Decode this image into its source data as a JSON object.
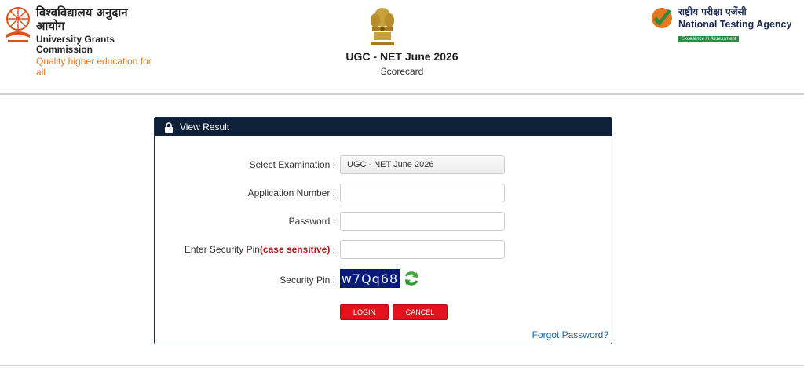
{
  "header": {
    "ugc": {
      "hindi": "विश्वविद्यालय अनुदान आयोग",
      "english": "University Grants Commission",
      "tagline": "Quality higher education for all"
    },
    "nta": {
      "hindi": "राष्ट्रीय परीक्षा एजेंसी",
      "english": "National Testing Agency",
      "tagline": "Excellence in Assessment"
    },
    "title": "UGC - NET June 2026",
    "subtitle": "Scorecard"
  },
  "panel": {
    "heading": "View Result",
    "fields": {
      "exam_label": "Select Examination :",
      "exam_value": "UGC - NET June 2026",
      "app_label": "Application Number :",
      "app_value": "",
      "password_label": "Password :",
      "password_value": "",
      "pin_label": "Enter Security Pin",
      "pin_note": "(case sensitive)",
      "pin_colon": " :",
      "pin_value": "",
      "captcha_label": "Security Pin :",
      "captcha_value": "w7Qq68"
    },
    "buttons": {
      "login": "LOGIN",
      "cancel": "CANCEL"
    },
    "forgot_password": "Forgot Password?"
  },
  "colors": {
    "panel_header": "#0f2139",
    "button": "#e3111b",
    "link": "#1a6aa8",
    "captcha_bg": "#0a1a7a",
    "ugc_tagline": "#e8761d",
    "nta_green": "#2d8a3e"
  },
  "icons": {
    "ugc": "ugc-emblem-icon",
    "national": "state-emblem-icon",
    "nta": "nta-check-icon",
    "lock": "lock-icon",
    "refresh": "refresh-icon"
  }
}
